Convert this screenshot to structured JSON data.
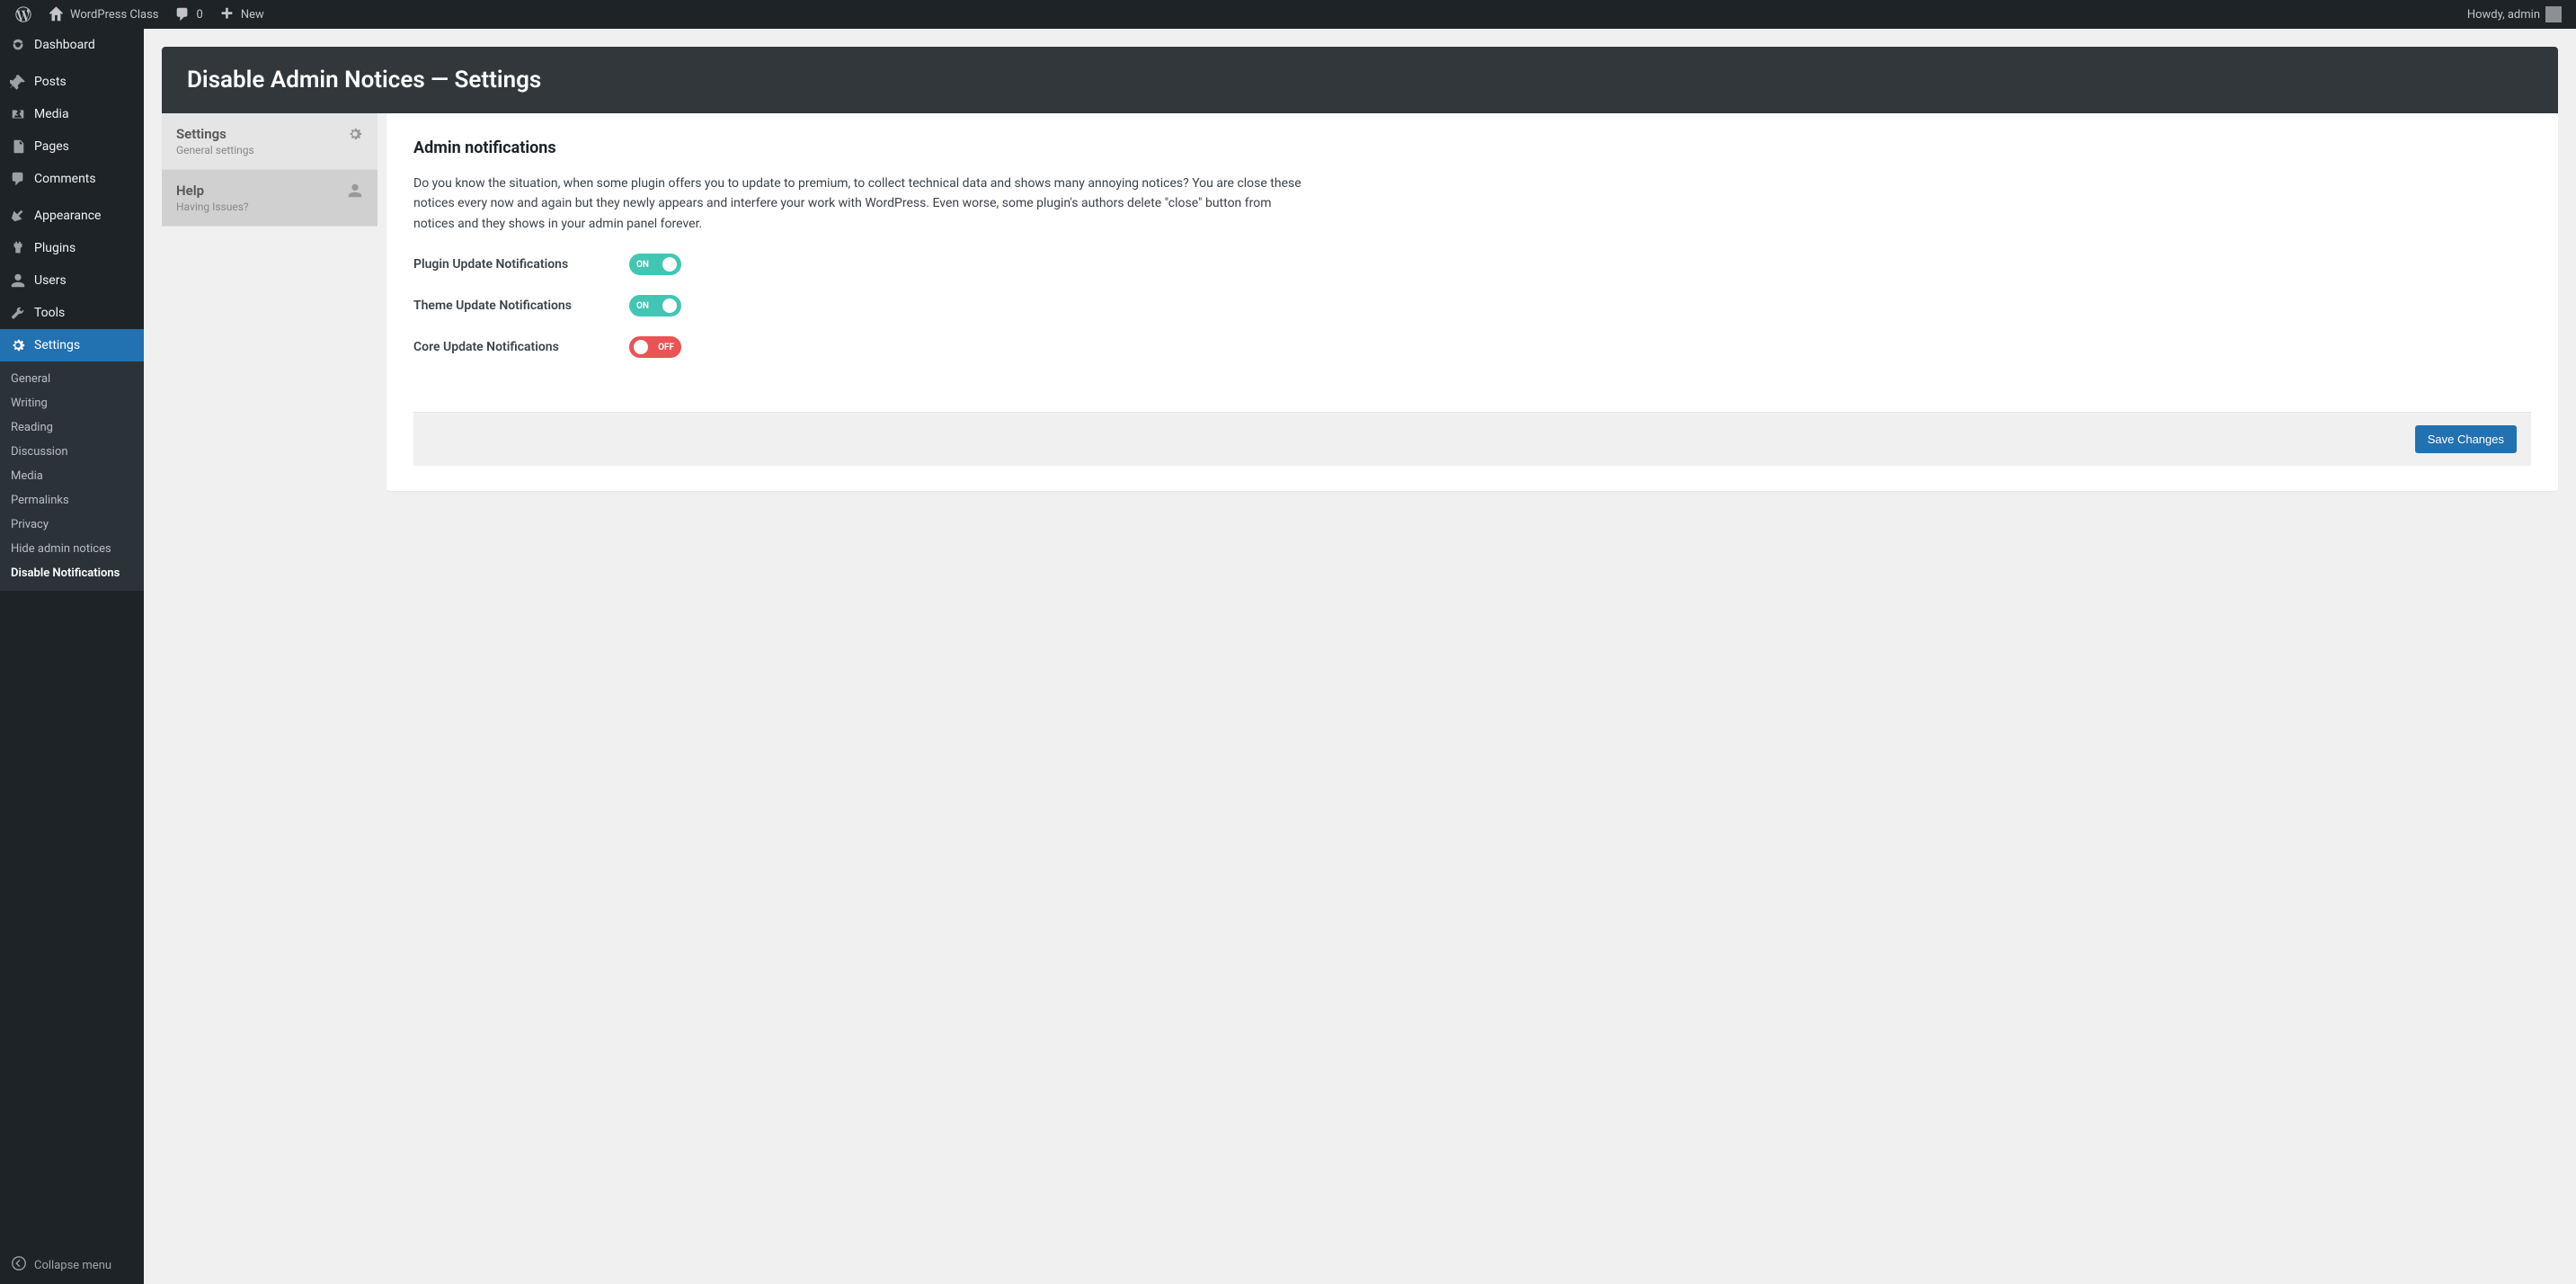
{
  "adminbar": {
    "site_name": "WordPress Class",
    "comments_count": "0",
    "new_label": "New",
    "howdy": "Howdy, admin"
  },
  "menu": {
    "items": [
      {
        "label": "Dashboard",
        "icon": "dashboard"
      },
      {
        "label": "Posts",
        "icon": "pin"
      },
      {
        "label": "Media",
        "icon": "media"
      },
      {
        "label": "Pages",
        "icon": "pages"
      },
      {
        "label": "Comments",
        "icon": "comments"
      },
      {
        "label": "Appearance",
        "icon": "appearance"
      },
      {
        "label": "Plugins",
        "icon": "plugins"
      },
      {
        "label": "Users",
        "icon": "users"
      },
      {
        "label": "Tools",
        "icon": "tools"
      },
      {
        "label": "Settings",
        "icon": "settings"
      }
    ],
    "submenu": [
      {
        "label": "General"
      },
      {
        "label": "Writing"
      },
      {
        "label": "Reading"
      },
      {
        "label": "Discussion"
      },
      {
        "label": "Media"
      },
      {
        "label": "Permalinks"
      },
      {
        "label": "Privacy"
      },
      {
        "label": "Hide admin notices"
      },
      {
        "label": "Disable Notifications"
      }
    ],
    "collapse": "Collapse menu"
  },
  "page": {
    "title": "Disable Admin Notices — Settings",
    "tabs": [
      {
        "title": "Settings",
        "sub": "General settings",
        "icon": "gear"
      },
      {
        "title": "Help",
        "sub": "Having Issues?",
        "icon": "person"
      }
    ],
    "section_heading": "Admin notifications",
    "intro": "Do you know the situation, when some plugin offers you to update to premium, to collect technical data and shows many annoying notices? You are close these notices every now and again but they newly appears and interfere your work with WordPress. Even worse, some plugin's authors delete \"close\" button from notices and they shows in your admin panel forever.",
    "options": [
      {
        "label": "Plugin Update Notifications",
        "state": "ON"
      },
      {
        "label": "Theme Update Notifications",
        "state": "ON"
      },
      {
        "label": "Core Update Notifications",
        "state": "OFF"
      }
    ],
    "save": "Save Changes"
  }
}
